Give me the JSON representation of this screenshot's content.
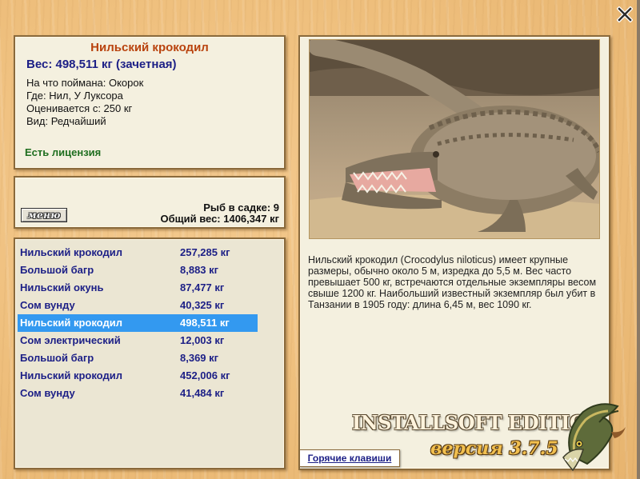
{
  "info": {
    "title": "Нильский крокодил",
    "weight": "Вес: 498,511 кг (зачетная)",
    "bait": "На что поймана: Окорок",
    "location": "Где: Нил, У Луксора",
    "valued_from": "Оценивается с: 250 кг",
    "rarity": "Вид: Редчайший",
    "license": "Есть лицензия"
  },
  "cage": {
    "menu_label": "меню",
    "fish_count": "Рыб в садке: 9",
    "total_weight": "Общий вес: 1406,347 кг"
  },
  "catch_list": [
    {
      "name": "Нильский крокодил",
      "weight": "257,285 кг",
      "selected": false
    },
    {
      "name": "Большой багр",
      "weight": "8,883 кг",
      "selected": false
    },
    {
      "name": "Нильский окунь",
      "weight": "87,477 кг",
      "selected": false
    },
    {
      "name": "Сом вунду",
      "weight": "40,325 кг",
      "selected": false
    },
    {
      "name": "Нильский крокодил",
      "weight": "498,511 кг",
      "selected": true
    },
    {
      "name": "Сом электрический",
      "weight": "12,003 кг",
      "selected": false
    },
    {
      "name": "Большой багр",
      "weight": "8,369 кг",
      "selected": false
    },
    {
      "name": "Нильский крокодил",
      "weight": "452,006 кг",
      "selected": false
    },
    {
      "name": "Сом вунду",
      "weight": "41,484 кг",
      "selected": false
    }
  ],
  "description": "Нильский крокодил (Crocodylus niloticus) имеет крупные размеры, обычно около 5 м, изредка до 5,5 м. Вес часто превышает 500 кг, встречаются отдельные экземпляры весом свыше 1200 кг. Наибольший известный экземпляр был убит в Танзании в 1905 году: длина 6,45 м, вес 1090 кг.",
  "hotkeys_label": "Горячие клавиши",
  "branding": {
    "edition": "INSTALLSOFT EDITION",
    "version": "версия 3.7.5"
  },
  "icons": [
    "close-icon",
    "crocodile-photo",
    "pike-logo"
  ],
  "colors": {
    "title": "#b9430e",
    "accent_text": "#1c1f86",
    "license": "#1f6e1f",
    "selection": "#3399f0"
  }
}
